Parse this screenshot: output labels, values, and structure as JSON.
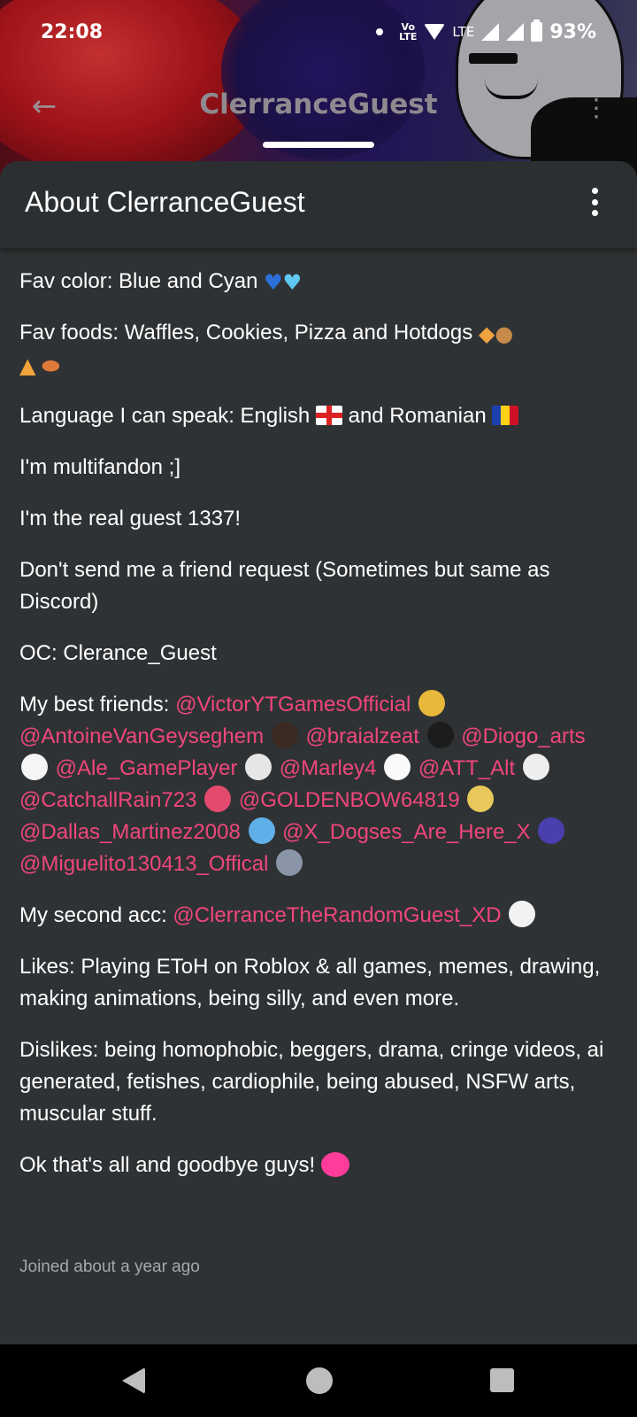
{
  "status_bar": {
    "time": "22:08",
    "volte_label": "Vo LTE",
    "network_label": "LTE",
    "battery": "93%"
  },
  "app_bar": {
    "title": "ClerranceGuest"
  },
  "sheet": {
    "title": "About ClerranceGuest"
  },
  "bio": {
    "fav_color": "Fav color: Blue and Cyan",
    "fav_foods": "Fav foods: Waffles, Cookies, Pizza and Hotdogs",
    "language_prefix": "Language I can speak: English",
    "language_mid": "and Romanian",
    "multifandom": "I'm multifandon ;]",
    "real_guest": "I'm the real guest 1337!",
    "friend_request": "Don't send me a friend request (Sometimes but same as Discord)",
    "oc": "OC: Clerance_Guest",
    "best_friends_label": "My best friends:",
    "best_friends": [
      "@VictorYTGamesOfficial",
      "@AntoineVanGeyseghem",
      "@braialzeat",
      "@Diogo_arts",
      "@Ale_GamePlayer",
      "@Marley4",
      "@ATT_Alt",
      "@CatchallRain723",
      "@GOLDENBOW64819",
      "@Dallas_Martinez2008",
      "@X_Dogses_Are_Here_X",
      "@Miguelito130413_Offical"
    ],
    "second_acc_label": "My second acc:",
    "second_acc": "@ClerranceTheRandomGuest_XD",
    "likes": "Likes: Playing EToH on Roblox & all games, memes, drawing, making animations, being silly, and even more.",
    "dislikes": "Dislikes: being homophobic, beggers, drama, cringe videos, ai generated, fetishes, cardiophile, being abused, NSFW arts, muscular stuff.",
    "goodbye": "Ok that's all and goodbye guys!"
  },
  "footer": {
    "joined": "Joined about a year ago"
  },
  "colors": {
    "mention": "#f0467c",
    "sheet_bg": "#2f3234"
  },
  "icons": [
    "back-arrow-icon",
    "overflow-menu-icon",
    "wifi-icon",
    "signal-icon",
    "battery-icon",
    "nav-back-icon",
    "nav-home-icon",
    "nav-recents-icon"
  ]
}
